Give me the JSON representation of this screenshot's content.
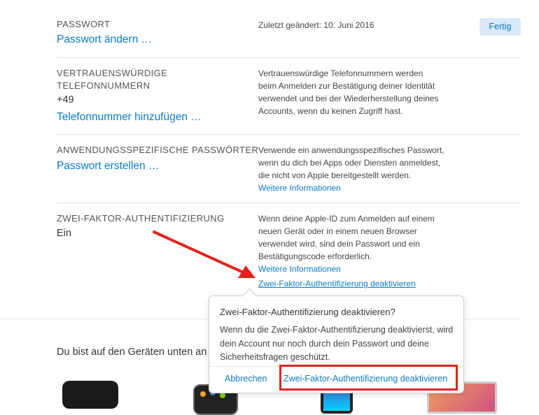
{
  "header": {
    "done_button": "Fertig"
  },
  "sections": [
    {
      "title": "PASSWORT",
      "link": "Passwort ändern …",
      "desc": "Zuletzt geändert: 10. Juni 2016"
    },
    {
      "title_line1": "VERTRAUENSWÜRDIGE",
      "title_line2": "TELEFONNUMMERN",
      "value": "+49",
      "link": "Telefonnummer hinzufügen …",
      "desc_lines": [
        "Vertrauenswürdige Telefonnummern werden",
        "beim Anmelden zur Bestätigung deiner Identität",
        "verwendet und bei der Wiederherstellung deines",
        "Accounts, wenn du keinen Zugriff hast."
      ]
    },
    {
      "title": "ANWENDUNGSSPEZIFISCHE PASSWÖRTER",
      "link": "Passwort erstellen …",
      "desc_lines": [
        "Verwende ein anwendungsspezifisches Passwort,",
        "wenn du dich bei Apps oder Diensten anmeldest,",
        "die nicht von Apple bereitgestellt werden."
      ],
      "more_link": "Weitere Informationen"
    },
    {
      "title": "ZWEI-FAKTOR-AUTHENTIFIZIERUNG",
      "value": "Ein",
      "desc_lines": [
        "Wenn deine Apple-ID zum Anmelden auf einem",
        "neuen Gerät oder in einem neuen Browser",
        "verwendet wird, sind dein Passwort und ein",
        "Bestätigungscode erforderlich."
      ],
      "more_link": "Weitere Informationen",
      "deactivate_link": "Zwei-Faktor-Authentifizierung deaktivieren"
    }
  ],
  "devices_heading": "Du bist auf den Geräten unten an",
  "popover": {
    "title": "Zwei-Faktor-Authentifizierung deaktivieren?",
    "body": "Wenn du die Zwei-Faktor-Authentifizierung deaktivierst, wird dein Account nur noch durch dein Passwort und deine Sicherheitsfragen geschützt.",
    "cancel": "Abbrechen",
    "confirm": "Zwei-Faktor-Authentifizierung deaktivieren"
  },
  "colors": {
    "link": "#0a7bc3",
    "annotation_red": "#e2231a",
    "button_bg": "#d9e9f9"
  },
  "devices": [
    "apple-tv-icon",
    "apple-watch-icon",
    "iphone-icon",
    "macbook-icon"
  ]
}
